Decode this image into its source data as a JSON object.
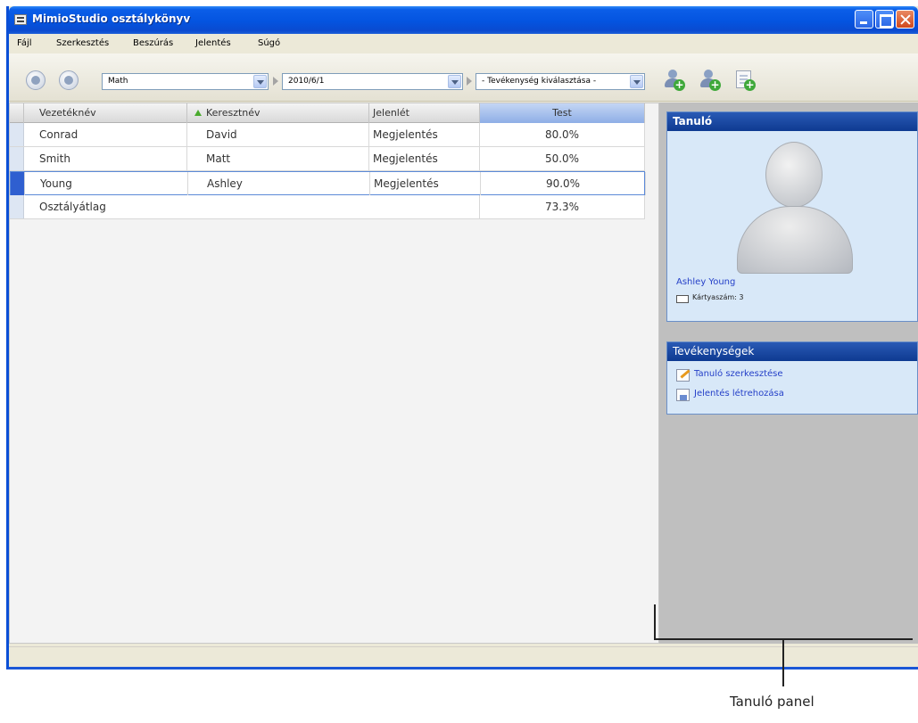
{
  "window": {
    "title": "MimioStudio osztálykönyv"
  },
  "menu": [
    "Fájl",
    "Szerkesztés",
    "Beszúrás",
    "Jelentés",
    "Súgó"
  ],
  "toolbar": {
    "class_select": "Math",
    "date_select": "2010/6/1",
    "activity_select": "- Tevékenység kiválasztása -"
  },
  "grid": {
    "columns": [
      "Vezetéknév",
      "Keresztnév",
      "Jelenlét",
      "Test"
    ],
    "sorted_column": "Keresztnév",
    "rows": [
      {
        "last": "Conrad",
        "first": "David",
        "attendance": "Megjelentés",
        "test": "80.0%"
      },
      {
        "last": "Smith",
        "first": "Matt",
        "attendance": "Megjelentés",
        "test": "50.0%"
      },
      {
        "last": "Young",
        "first": "Ashley",
        "attendance": "Megjelentés",
        "test": "90.0%"
      },
      {
        "last": "Osztályátlag",
        "first": "",
        "attendance": "",
        "test": "73.3%"
      }
    ],
    "selected_row": 2
  },
  "student_panel": {
    "title": "Tanuló",
    "name": "Ashley Young",
    "card_label": "Kártyaszám: 3"
  },
  "activities_panel": {
    "title": "Tevékenységek",
    "items": [
      "Tanuló szerkesztése",
      "Jelentés létrehozása"
    ]
  },
  "callout": {
    "label": "Tanuló panel"
  },
  "colors": {
    "titlebar": "#0454e0",
    "panel_header": "#0e3a91",
    "link": "#2540c8",
    "sort_indicator": "#4aab2e"
  }
}
